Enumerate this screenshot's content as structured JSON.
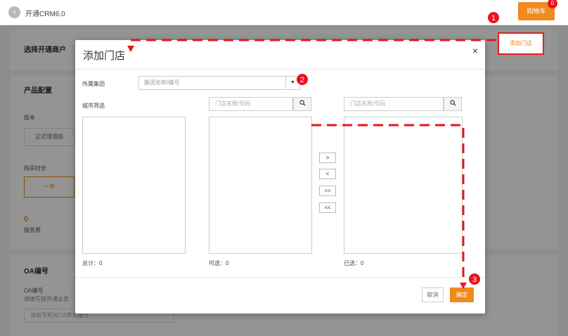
{
  "header": {
    "title": "开通CRM6.0",
    "cart_label": "购物车",
    "cart_count": "0"
  },
  "background": {
    "section_merchant": "选择开通商户",
    "add_store_button": "添加门店",
    "section_product": "产品配置",
    "version_label": "版本",
    "version_value": "正式增强版",
    "duration_label": "购买时长",
    "duration_value": "一年",
    "fee_value": "0",
    "fee_label": "服务费",
    "section_oa": "OA编号",
    "oa_label": "OA编号",
    "oa_hint": "请填写获开通业务",
    "oa_placeholder": "请填写相关OA审批编号"
  },
  "modal": {
    "title": "添加门店",
    "close": "×",
    "group_label": "所属集团",
    "group_placeholder": "集团名称/编号",
    "city_filter_label": "城市筛选",
    "search_placeholder_available": "门店名称/号码",
    "search_placeholder_selected": "门店名称/号码",
    "transfer": {
      "add": ">",
      "remove": "<",
      "add_all": ">>",
      "remove_all": "<<"
    },
    "total_label": "总计：0",
    "available_label": "可选：0",
    "selected_label": "已选：0",
    "cancel_label": "取消",
    "confirm_label": "确定"
  },
  "steps": {
    "one": "1",
    "two": "2",
    "three": "3"
  },
  "colors": {
    "accent": "#f08a1c",
    "annotation": "#e8141e"
  },
  "icons": {
    "back": "chevron-left-icon",
    "search": "search-icon",
    "dropdown": "caret-down-icon",
    "close": "close-icon"
  }
}
